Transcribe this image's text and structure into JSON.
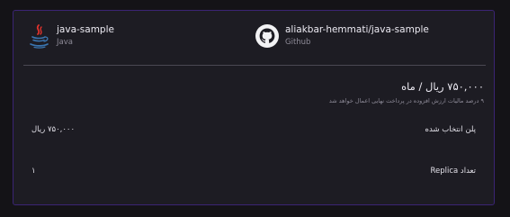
{
  "app": {
    "name": "java-sample",
    "language": "Java",
    "icon": "java-icon"
  },
  "repository": {
    "name": "aliakbar-hemmati/java-sample",
    "provider": "Github",
    "icon": "github-icon"
  },
  "pricing": {
    "price_text": "۷۵۰,۰۰۰ ریال / ماه",
    "tax_note": "۹ درصد مالیات ارزش افزوده در پرداخت نهایی اعمال خواهد شد"
  },
  "details": [
    {
      "label": "پلن انتخاب شده",
      "value": "۷۵۰,۰۰۰ ریال"
    },
    {
      "label": "تعداد Replica",
      "value": "۱"
    }
  ],
  "colors": {
    "page_background": "#141317",
    "card_background": "#1d1c23",
    "card_border": "#3b2474",
    "java_red": "#e2322c",
    "java_blue": "#3a75b0"
  }
}
